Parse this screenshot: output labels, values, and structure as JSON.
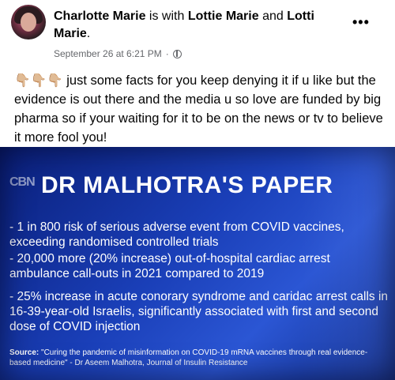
{
  "post": {
    "author": "Charlotte Marie",
    "with_text": "is with",
    "tagged_1": "Lottie Marie",
    "and_text": "and",
    "tagged_2": "Lotti Marie",
    "tail": ".",
    "timestamp": "September 26 at 6:21 PM",
    "separator": "·",
    "privacy_icon": "globe-icon",
    "more_icon": "more-options-icon",
    "emojis": "👇🏼👇🏼👇🏼",
    "body": "just some facts for you keep denying it if u like but the evidence is out there and the media u so love are funded by big pharma so if your waiting for it to be on the news or tv to believe it more fool you!"
  },
  "media": {
    "channel_logo": "CBN",
    "title": "DR MALHOTRA'S PAPER",
    "items": [
      "- 1 in 800 risk of serious adverse event from COVID vaccines, exceeding randomised controlled trials",
      "- 20,000 more (20% increase) out-of-hospital cardiac arrest ambulance call-outs in 2021 compared to 2019",
      "- 25% increase in acute conorary syndrome and caridac arrest calls in 16-39-year-old Israelis, significantly associated with first and second dose of COVID injection"
    ],
    "source_label": "Source:",
    "source_text": "\"Curing the pandemic of misinformation on COVID-19 mRNA vaccines through real evidence-based medicine\" - Dr Aseem Malhotra, Journal of Insulin Resistance"
  }
}
